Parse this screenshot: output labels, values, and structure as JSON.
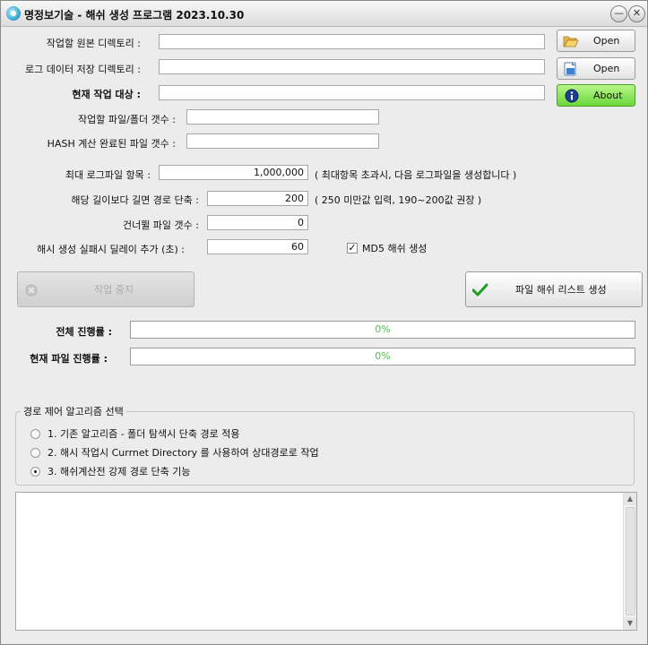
{
  "window": {
    "title": "명정보기술 - 해쉬 생성 프로그램  2023.10.30",
    "minimize_glyph": "—",
    "close_glyph": "✕"
  },
  "paths": {
    "source_label": "작업할 원본 디렉토리 :",
    "source_value": "",
    "log_label": "로그 데이터 저장 디렉토리 :",
    "log_value": "",
    "current_label": "현재 작업 대상 :",
    "current_value": ""
  },
  "buttons": {
    "open1": "Open",
    "open2": "Open",
    "about": "About",
    "stop": "작업 중지",
    "generate": "파일 해쉬 리스트 생성"
  },
  "counts": {
    "files_label": "작업할 파일/폴더 갯수 :",
    "files_value": "",
    "hash_done_label": "HASH 계산 완료된 파일 갯수 :",
    "hash_done_value": ""
  },
  "settings": {
    "max_log_label": "최대 로그파일 항목 :",
    "max_log_value": "1,000,000",
    "max_log_hint": "( 최대항목 초과시, 다음 로그파일을 생성합니다 )",
    "path_len_label": "해당 길이보다 길면 경로 단축 :",
    "path_len_value": "200",
    "path_len_hint": "( 250 미만값 입력, 190~200값 권장 )",
    "skip_label": "건너뛸 파일 갯수 :",
    "skip_value": "0",
    "delay_label": "해시 생성 실패시 딜레이 추가 (초) :",
    "delay_value": "60",
    "md5_label": "MD5 해쉬 생성",
    "md5_checked": true
  },
  "progress": {
    "total_label": "전체 진행률 :",
    "total_text": "0%",
    "total_fraction": 0,
    "file_label": "현재 파일 진행률 :",
    "file_text": "0%",
    "file_fraction": 0
  },
  "algorithm": {
    "legend": "경로 제어 알고리즘 선택",
    "options": [
      {
        "label": "1. 기존 알고리즘 - 폴더 탐색시 단축 경로 적용",
        "selected": false
      },
      {
        "label": "2. 해시 작업시 Currnet Directory 를 사용하여 상대경로로 작업",
        "selected": false
      },
      {
        "label": "3. 해쉬계산전 강제 경로 단축 기능",
        "selected": true
      }
    ]
  },
  "log": {
    "text": ""
  },
  "icons": {
    "app": "app-icon",
    "folder": "folder-open-icon",
    "save": "save-folder-icon",
    "info": "info-icon",
    "stop": "stop-icon",
    "check": "checkmark-icon"
  },
  "colors": {
    "about_button": "#6bd83b",
    "progress_text": "#4ec04e",
    "check_green": "#1e9e1e"
  }
}
